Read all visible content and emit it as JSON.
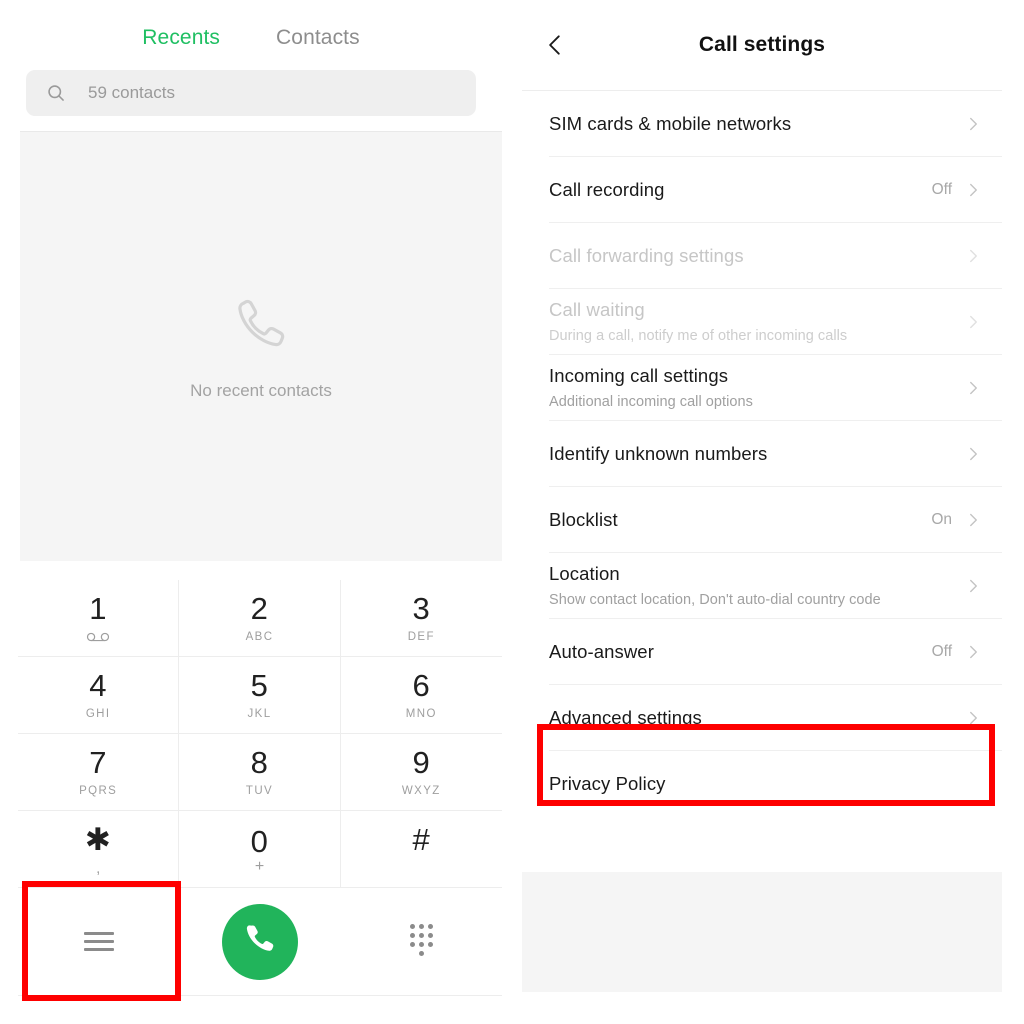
{
  "dialer": {
    "tabs": [
      {
        "label": "Recents",
        "active": true
      },
      {
        "label": "Contacts",
        "active": false
      }
    ],
    "search": {
      "placeholder": "59 contacts",
      "icon": "search-icon"
    },
    "recents_empty": {
      "icon": "phone-outline-icon",
      "text": "No recent contacts"
    },
    "keypad": [
      {
        "digit": "1",
        "sub": "",
        "icon": "voicemail-icon"
      },
      {
        "digit": "2",
        "sub": "ABC",
        "icon": ""
      },
      {
        "digit": "3",
        "sub": "DEF",
        "icon": ""
      },
      {
        "digit": "4",
        "sub": "GHI",
        "icon": ""
      },
      {
        "digit": "5",
        "sub": "JKL",
        "icon": ""
      },
      {
        "digit": "6",
        "sub": "MNO",
        "icon": ""
      },
      {
        "digit": "7",
        "sub": "PQRS",
        "icon": ""
      },
      {
        "digit": "8",
        "sub": "TUV",
        "icon": ""
      },
      {
        "digit": "9",
        "sub": "WXYZ",
        "icon": ""
      },
      {
        "digit": "✱",
        "sub": ",",
        "icon": ""
      },
      {
        "digit": "0",
        "sub": "+",
        "icon": ""
      },
      {
        "digit": "#",
        "sub": "",
        "icon": ""
      }
    ],
    "actions": {
      "menu_icon": "hamburger-menu-icon",
      "call_icon": "phone-call-icon",
      "keypad_icon": "dialpad-grid-icon",
      "call_button_color": "#21b45b"
    }
  },
  "settings": {
    "back_icon": "chevron-left-icon",
    "title": "Call settings",
    "items": [
      {
        "label": "SIM cards & mobile networks",
        "sub": "",
        "value": "",
        "disabled": false
      },
      {
        "label": "Call recording",
        "sub": "",
        "value": "Off",
        "disabled": false
      },
      {
        "label": "Call forwarding settings",
        "sub": "",
        "value": "",
        "disabled": true
      },
      {
        "label": "Call waiting",
        "sub": "During a call, notify me of other incoming calls",
        "value": "",
        "disabled": true
      },
      {
        "label": "Incoming call settings",
        "sub": "Additional incoming call options",
        "value": "",
        "disabled": false
      },
      {
        "label": "Identify unknown numbers",
        "sub": "",
        "value": "",
        "disabled": false
      },
      {
        "label": "Blocklist",
        "sub": "",
        "value": "On",
        "disabled": false
      },
      {
        "label": "Location",
        "sub": "Show contact location, Don't auto-dial country code",
        "value": "",
        "disabled": false
      },
      {
        "label": "Auto-answer",
        "sub": "",
        "value": "Off",
        "disabled": false
      },
      {
        "label": "Advanced settings",
        "sub": "",
        "value": "",
        "disabled": false
      },
      {
        "label": "Privacy Policy",
        "sub": "",
        "value": "",
        "disabled": false
      }
    ]
  },
  "highlights": {
    "color": "#fe0000",
    "targets": [
      "hamburger-menu-button",
      "advanced-settings-row"
    ]
  }
}
